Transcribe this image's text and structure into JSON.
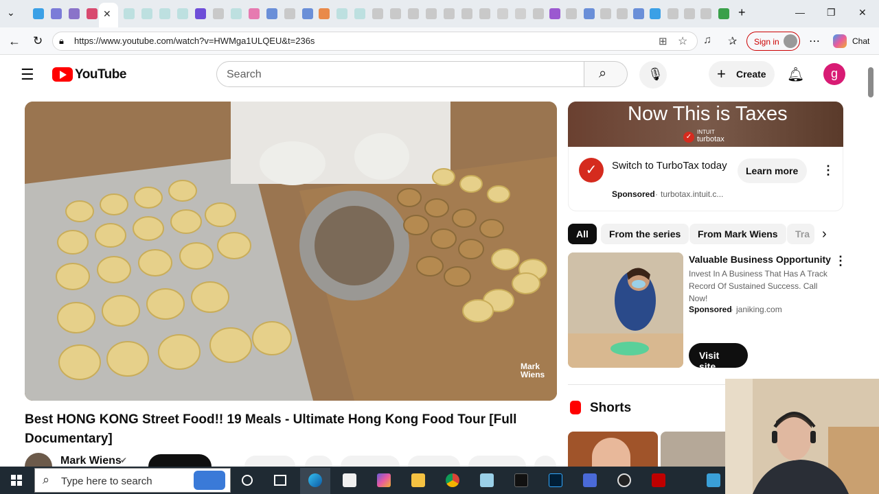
{
  "browser": {
    "url": "https://www.youtube.com/watch?v=HWMga1ULQEU&t=236s",
    "signin_label": "Sign in",
    "chat_label": "Chat"
  },
  "youtube": {
    "logo_text": "YouTube",
    "search_placeholder": "Search",
    "create_label": "Create",
    "avatar_letter": "g"
  },
  "video": {
    "title": "Best HONG KONG Street Food!! 19 Meals - Ultimate Hong Kong Food Tour [Full Documentary]",
    "channel": "Mark Wiens",
    "watermark": "Mark Wiens"
  },
  "sidebar": {
    "ad": {
      "banner_text": "Now This is Taxes",
      "banner_brand": "turbotax",
      "banner_brand_top": "INTUIT",
      "title": "Switch to TurboTax today",
      "sponsored": "Sponsored",
      "domain": "turbotax.intuit.c...",
      "cta": "Learn more"
    },
    "chips": [
      "All",
      "From the series",
      "From Mark Wiens",
      "Tra"
    ],
    "promo": {
      "title": "Valuable Business Opportunity",
      "desc": "Invest In A Business That Has A Track Record Of Sustained Success. Call Now!",
      "sponsored": "Sponsored",
      "domain": "janiking.com",
      "cta": "Visit site"
    },
    "shorts_label": "Shorts"
  },
  "taskbar": {
    "search_placeholder": "Type here to search"
  },
  "colors": {
    "yt_red": "#ff0000",
    "turbotax_red": "#d52b1e",
    "taskbar": "#1f2a33"
  }
}
